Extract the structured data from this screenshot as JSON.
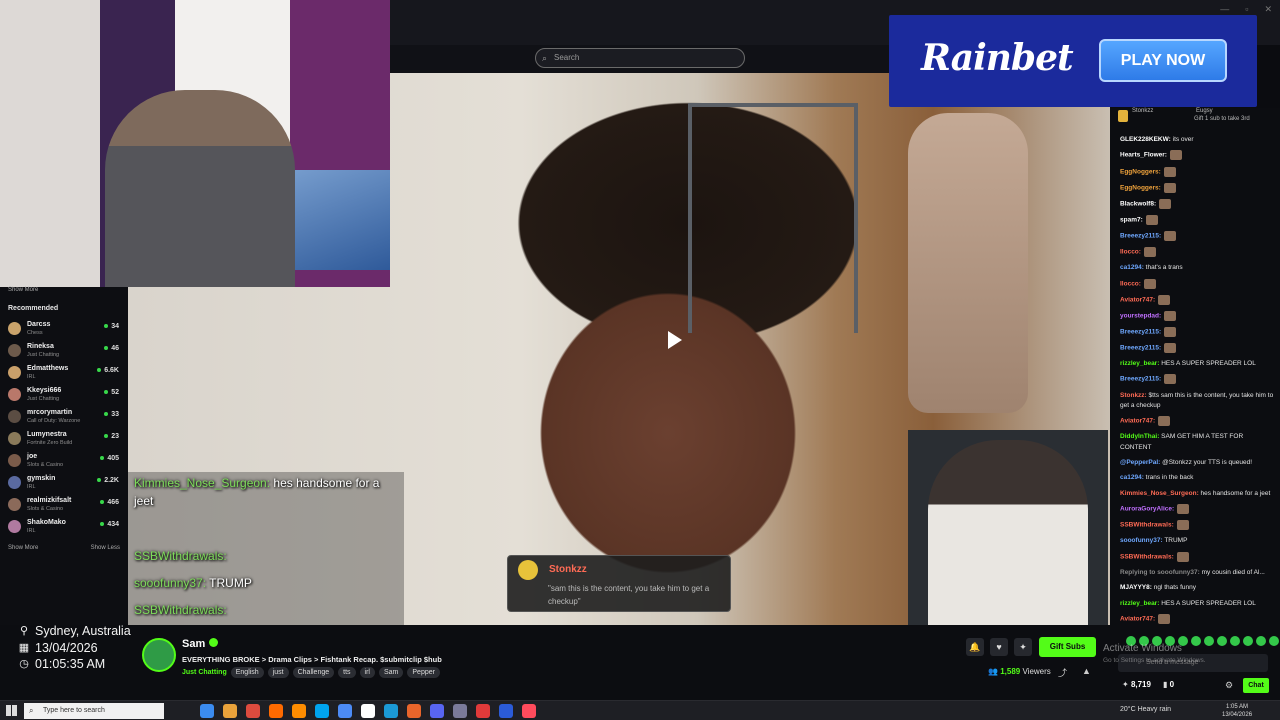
{
  "window": {
    "controls": [
      "—",
      "▫",
      "✕"
    ]
  },
  "search": {
    "placeholder": "Search"
  },
  "sidebar": {
    "show_more_top": "Show More",
    "recommended_title": "Recommended",
    "items": [
      {
        "name": "Darcss",
        "category": "Chess",
        "viewers": "34",
        "color": "#c9a36b"
      },
      {
        "name": "Rineksa",
        "category": "Just Chatting",
        "viewers": "46",
        "color": "#6d5a4b"
      },
      {
        "name": "Edmatthews",
        "category": "IRL",
        "viewers": "6.6K",
        "color": "#caa06a"
      },
      {
        "name": "Kkeysi666",
        "category": "Just Chatting",
        "viewers": "52",
        "color": "#b9786a"
      },
      {
        "name": "mrcorymartin",
        "category": "Call of Duty: Warzone",
        "viewers": "33",
        "color": "#5b4d43"
      },
      {
        "name": "Lumynestra",
        "category": "Fortnite Zero Build",
        "viewers": "23",
        "color": "#8a7a5a"
      },
      {
        "name": "joe",
        "category": "Slots & Casino",
        "viewers": "405",
        "color": "#7a5b4a"
      },
      {
        "name": "gymskin",
        "category": "IRL",
        "viewers": "2.2K",
        "color": "#5a6aa0"
      },
      {
        "name": "realmizkifsalt",
        "category": "Slots & Casino",
        "viewers": "466",
        "color": "#8b6a5a"
      },
      {
        "name": "ShakoMako",
        "category": "IRL",
        "viewers": "434",
        "color": "#b07aa0"
      }
    ],
    "show_more": "Show More",
    "show_less": "Show Less"
  },
  "overlay_chat": [
    {
      "user": "Kimmies_Nose_Surgeon:",
      "text": " hes handsome for a",
      "user_color": "#7ddc5a"
    },
    {
      "user": "",
      "text": "jeet",
      "user_color": "#ffffff"
    },
    {
      "user": "SSBWithdrawals:",
      "text": "",
      "user_color": "#7ddc5a"
    },
    {
      "user": "sooofunny37:",
      "text": " TRUMP",
      "user_color": "#7ddc5a"
    },
    {
      "user": "SSBWithdrawals:",
      "text": "",
      "user_color": "#7ddc5a"
    }
  ],
  "tts": {
    "name": "Stonkzz",
    "message": "\"sam this is the content, you take him to get a checkup\""
  },
  "location": {
    "city": "Sydney, Australia",
    "date": "13/04/2026",
    "time": "01:05:35 AM"
  },
  "stream": {
    "streamer": "Sam",
    "title": "EVERYTHING BROKE > Drama Clips > Fishtank Recap. $submitclip $hub",
    "category": "Just Chatting",
    "tags": [
      "English",
      "just",
      "Challenge",
      "tts",
      "irl",
      "Sam",
      "Pepper"
    ],
    "viewers": "1,589",
    "viewers_label": "Viewers",
    "gift_label": "Gift Subs"
  },
  "ad": {
    "brand": "Rainbet",
    "cta": "PLAY NOW"
  },
  "chat": {
    "top": {
      "left": "Stonkzz",
      "leftsub": "2",
      "right": "Eugsy",
      "right_sub": "Gift 1 sub to take 3rd"
    },
    "messages": [
      {
        "user": "GLEK228KEKW:",
        "text": " its over",
        "color": "#ffffff"
      },
      {
        "user": "Hearts_Flower:",
        "text": "",
        "color": "#ffffff"
      },
      {
        "user": "EggNoggers:",
        "text": "",
        "color": "#f0a33c"
      },
      {
        "user": "EggNoggers:",
        "text": "",
        "color": "#f0a33c"
      },
      {
        "user": "Blackwolf8:",
        "text": "",
        "color": "#ffffff"
      },
      {
        "user": "spam7:",
        "text": "",
        "color": "#ffffff"
      },
      {
        "user": "Breeezy2115:",
        "text": "",
        "color": "#6fa8ff"
      },
      {
        "user": "Ilocco:",
        "text": "",
        "color": "#ff6b55"
      },
      {
        "user": "ca1294:",
        "text": " that's a trans",
        "color": "#6fa8ff"
      },
      {
        "user": "Ilocco:",
        "text": "",
        "color": "#ff6b55"
      },
      {
        "user": "Aviator747:",
        "text": "",
        "color": "#ff6b55"
      },
      {
        "user": "yourstepdad:",
        "text": "",
        "color": "#c070ff"
      },
      {
        "user": "Breeezy2115:",
        "text": "",
        "color": "#6fa8ff"
      },
      {
        "user": "Breeezy2115:",
        "text": "",
        "color": "#6fa8ff"
      },
      {
        "user": "rizzley_bear:",
        "text": " HES A SUPER SPREADER LOL",
        "color": "#53fc18"
      },
      {
        "user": "Breeezy2115:",
        "text": "",
        "color": "#6fa8ff"
      },
      {
        "user": "Stonkzz:",
        "text": " $tts sam this is the content, you take him to get a checkup",
        "color": "#ff6b55"
      },
      {
        "user": "Aviator747:",
        "text": "",
        "color": "#ff6b55"
      },
      {
        "user": "DiddyInThai:",
        "text": " SAM GET HIM A TEST FOR CONTENT",
        "color": "#53fc18"
      },
      {
        "user": "@PepperPal:",
        "text": " @Stonkzz your TTS is queued!",
        "color": "#6fa8ff"
      },
      {
        "user": "ca1294:",
        "text": " trans in the back",
        "color": "#6fa8ff"
      },
      {
        "user": "Kimmies_Nose_Surgeon:",
        "text": " hes handsome for a jeet",
        "color": "#ff6b55"
      },
      {
        "user": "AuroraGoryAlice:",
        "text": "",
        "color": "#c070ff"
      },
      {
        "user": "SSBWithdrawals:",
        "text": "",
        "color": "#ff6b55"
      },
      {
        "user": "sooofunny37:",
        "text": " TRUMP",
        "color": "#6fa8ff"
      },
      {
        "user": "SSBWithdrawals:",
        "text": "",
        "color": "#ff6b55"
      },
      {
        "user": "Replying to sooofunny37:",
        "text": " my cousin died of Al...",
        "color": "#888888"
      },
      {
        "user": "MJAYYY8:",
        "text": " ngl thats funny",
        "color": "#ffffff"
      },
      {
        "user": "rizzley_bear:",
        "text": " HES A SUPER SPREADER LOL",
        "color": "#53fc18"
      },
      {
        "user": "Aviator747:",
        "text": "",
        "color": "#ff6b55"
      }
    ],
    "input_placeholder": "Send a message",
    "points": "8,719",
    "subs": "0",
    "chat_button": "Chat"
  },
  "watermark": {
    "line1": "Activate Windows",
    "line2": "Go to Settings to activate Windows."
  },
  "taskbar": {
    "search_placeholder": "Type here to search",
    "weather": "20°C  Heavy rain",
    "time": "1:05 AM",
    "date": "13/04/2026",
    "apps": [
      "#3b8cf0",
      "#e9a23b",
      "#dd4b3e",
      "#ff6a00",
      "#fe8d01",
      "#00a4ef",
      "#4c8bf5",
      "#ffffff",
      "#1b9ad6",
      "#e8652b",
      "#5865f2",
      "#7a7a9a",
      "#e03a3a",
      "#2b5bd7",
      "#ff4b5c"
    ]
  }
}
